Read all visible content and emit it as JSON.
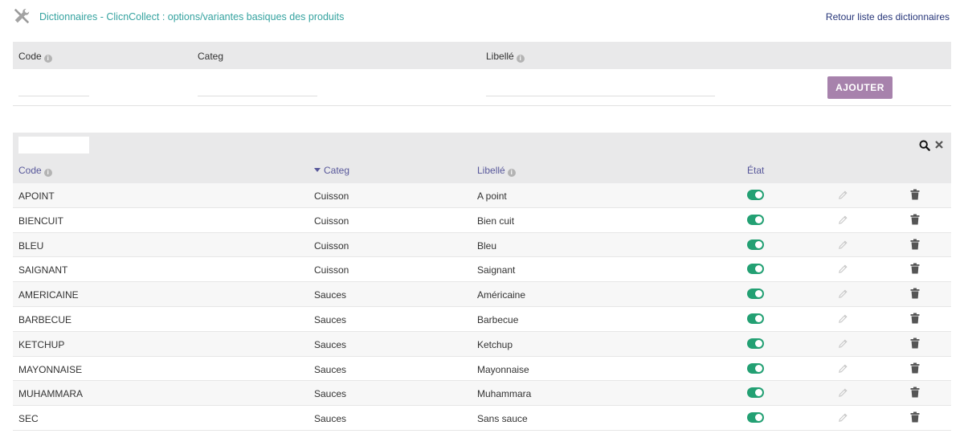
{
  "header": {
    "title": "Dictionnaires - ClicnCollect : options/variantes basiques des produits",
    "back_link": "Retour liste des dictionnaires"
  },
  "add_form": {
    "col_code": "Code",
    "col_categ": "Categ",
    "col_libelle": "Libellé",
    "add_button": "AJOUTER"
  },
  "list": {
    "columns": {
      "code": "Code",
      "categ": "Categ",
      "libelle": "Libellé",
      "etat": "État"
    },
    "sort": {
      "column": "categ",
      "direction": "desc"
    },
    "rows": [
      {
        "code": "APOINT",
        "categ": "Cuisson",
        "libelle": "A point",
        "active": true
      },
      {
        "code": "BIENCUIT",
        "categ": "Cuisson",
        "libelle": "Bien cuit",
        "active": true
      },
      {
        "code": "BLEU",
        "categ": "Cuisson",
        "libelle": "Bleu",
        "active": true
      },
      {
        "code": "SAIGNANT",
        "categ": "Cuisson",
        "libelle": "Saignant",
        "active": true
      },
      {
        "code": "AMERICAINE",
        "categ": "Sauces",
        "libelle": "Américaine",
        "active": true
      },
      {
        "code": "BARBECUE",
        "categ": "Sauces",
        "libelle": "Barbecue",
        "active": true
      },
      {
        "code": "KETCHUP",
        "categ": "Sauces",
        "libelle": "Ketchup",
        "active": true
      },
      {
        "code": "MAYONNAISE",
        "categ": "Sauces",
        "libelle": "Mayonnaise",
        "active": true
      },
      {
        "code": "MUHAMMARA",
        "categ": "Sauces",
        "libelle": "Muhammara",
        "active": true
      },
      {
        "code": "SEC",
        "categ": "Sauces",
        "libelle": "Sans sauce",
        "active": true
      }
    ]
  },
  "colors": {
    "title": "#36a3a0",
    "link": "#263579",
    "header_text": "#57579a",
    "add_button": "#a782ac",
    "toggle_on": "#23a073"
  },
  "icons": {
    "page": "tools-icon",
    "info": "info-icon",
    "search": "search-icon",
    "clear": "close-icon",
    "edit": "pencil-icon",
    "delete": "trash-icon",
    "sort": "caret-down-icon"
  }
}
